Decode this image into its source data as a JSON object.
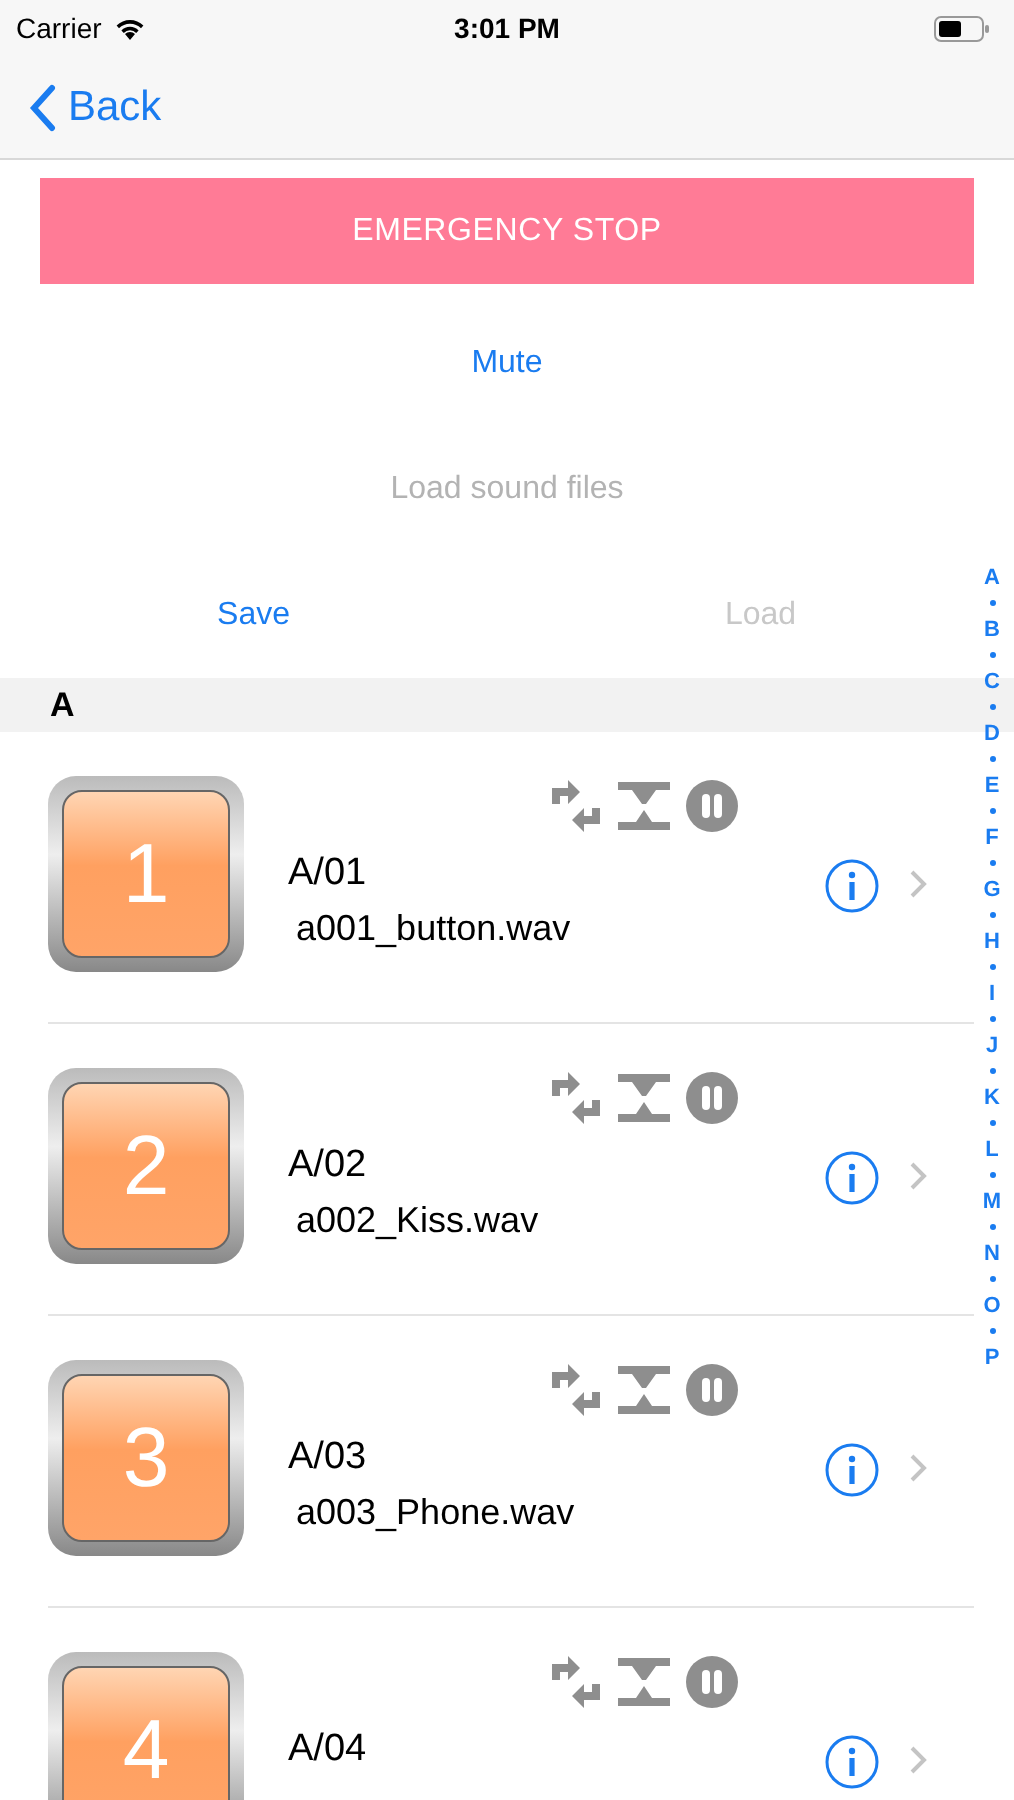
{
  "status_bar": {
    "carrier": "Carrier",
    "time": "3:01 PM"
  },
  "nav": {
    "back": "Back"
  },
  "emergency_button": "EMERGENCY STOP",
  "actions": [
    {
      "label": "Mute",
      "disabled": false
    },
    {
      "label": "Load sound files",
      "disabled": true
    }
  ],
  "file_buttons": [
    {
      "label": "Save",
      "disabled": false
    },
    {
      "label": "Load",
      "disabled": true
    }
  ],
  "section": {
    "title": "A"
  },
  "rows": [
    {
      "number": "1",
      "title": "A/01",
      "filename": "a001_button.wav"
    },
    {
      "number": "2",
      "title": "A/02",
      "filename": "a002_Kiss.wav"
    },
    {
      "number": "3",
      "title": "A/03",
      "filename": "a003_Phone.wav"
    },
    {
      "number": "4",
      "title": "A/04"
    }
  ],
  "index": [
    "A",
    "B",
    "C",
    "D",
    "E",
    "F",
    "G",
    "H",
    "I",
    "J",
    "K",
    "L",
    "M",
    "N",
    "O",
    "P"
  ]
}
